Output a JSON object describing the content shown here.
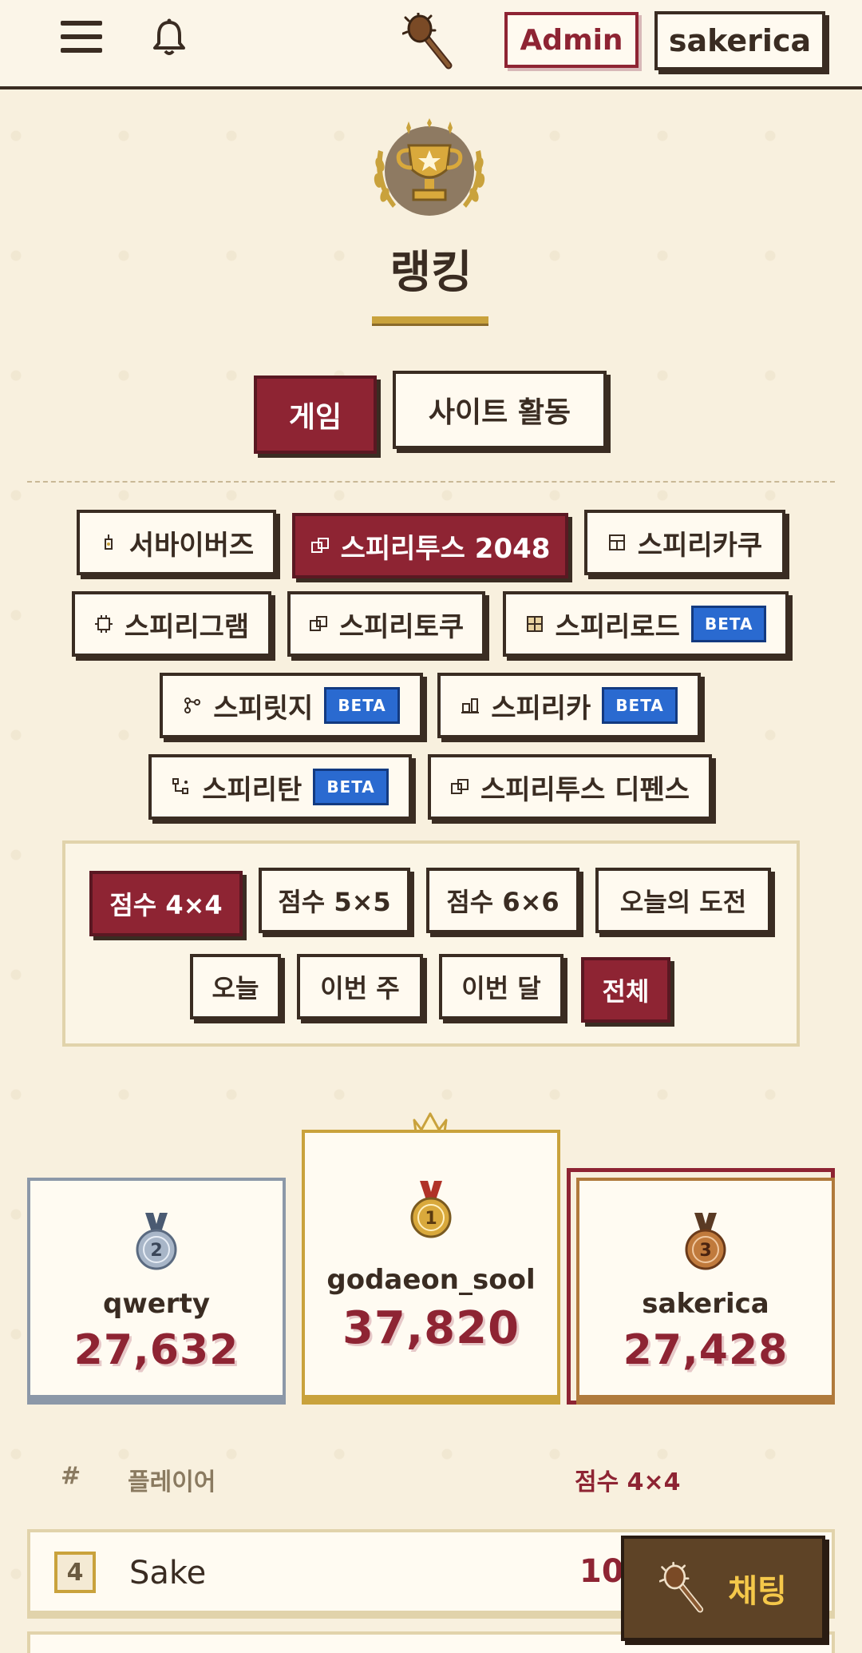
{
  "header": {
    "admin_label": "Admin",
    "user_label": "sakerica"
  },
  "page": {
    "title": "랭킹"
  },
  "main_tabs": [
    {
      "label": "게임",
      "active": true
    },
    {
      "label": "사이트 활동",
      "active": false
    }
  ],
  "games": [
    {
      "label": "서바이버즈",
      "icon": "lamp-icon",
      "active": false,
      "beta": false
    },
    {
      "label": "스피리투스 2048",
      "icon": "tiles-icon",
      "active": true,
      "beta": false
    },
    {
      "label": "스피리카쿠",
      "icon": "grid-icon",
      "active": false,
      "beta": false
    },
    {
      "label": "스피리그램",
      "icon": "chip-icon",
      "active": false,
      "beta": false
    },
    {
      "label": "스피리토쿠",
      "icon": "tiles-icon",
      "active": false,
      "beta": false
    },
    {
      "label": "스피리로드",
      "icon": "board-icon",
      "active": false,
      "beta": true
    },
    {
      "label": "스피릿지",
      "icon": "nodes-icon",
      "active": false,
      "beta": true
    },
    {
      "label": "스피리카",
      "icon": "cart-icon",
      "active": false,
      "beta": true
    },
    {
      "label": "스피리탄",
      "icon": "branch-icon",
      "active": false,
      "beta": true
    },
    {
      "label": "스피리투스 디펜스",
      "icon": "tiles-icon",
      "active": false,
      "beta": false
    }
  ],
  "beta_label": "BETA",
  "filters": {
    "modes": [
      {
        "label": "점수 4×4",
        "active": true
      },
      {
        "label": "점수 5×5",
        "active": false
      },
      {
        "label": "점수 6×6",
        "active": false
      },
      {
        "label": "오늘의 도전",
        "active": false
      }
    ],
    "periods": [
      {
        "label": "오늘",
        "active": false
      },
      {
        "label": "이번 주",
        "active": false
      },
      {
        "label": "이번 달",
        "active": false
      },
      {
        "label": "전체",
        "active": true
      }
    ]
  },
  "podium": {
    "first": {
      "rank": "1",
      "name": "godaeon_sool",
      "score": "37,820"
    },
    "second": {
      "rank": "2",
      "name": "qwerty",
      "score": "27,632"
    },
    "third": {
      "rank": "3",
      "name": "sakerica",
      "score": "27,428"
    }
  },
  "table": {
    "col_rank": "#",
    "col_player": "플레이어",
    "col_score": "점수 4×4",
    "rows": [
      {
        "rank": "4",
        "name": "Sake",
        "score": "10,"
      }
    ]
  },
  "chat": {
    "label": "채팅"
  },
  "colors": {
    "accent": "#8e2433",
    "background": "#f8f0de",
    "ink": "#3a2c22",
    "gold": "#c9a23c",
    "beta_blue": "#2a6ad0"
  }
}
